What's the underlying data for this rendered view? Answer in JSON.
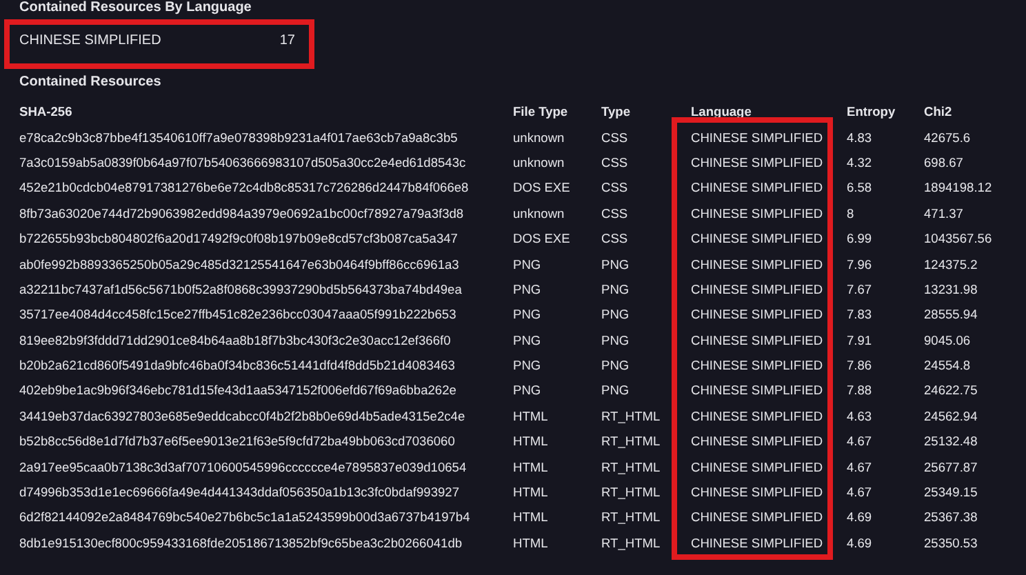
{
  "summary": {
    "title": "Contained Resources By Language",
    "rows": [
      {
        "language": "CHINESE SIMPLIFIED",
        "count": "17",
        "highlighted": true
      }
    ]
  },
  "resources": {
    "title": "Contained Resources",
    "columns": [
      {
        "label": "SHA-256",
        "highlighted": false
      },
      {
        "label": "File Type",
        "highlighted": false
      },
      {
        "label": "Type",
        "highlighted": false
      },
      {
        "label": "Language",
        "highlighted": true
      },
      {
        "label": "Entropy",
        "highlighted": false
      },
      {
        "label": "Chi2",
        "highlighted": false
      }
    ],
    "rows": [
      [
        "e78ca2c9b3c87bbe4f13540610ff7a9e078398b9231a4f017ae63cb7a9a8c3b5",
        "unknown",
        "CSS",
        "CHINESE SIMPLIFIED",
        "4.83",
        "42675.6"
      ],
      [
        "7a3c0159ab5a0839f0b64a97f07b54063666983107d505a30cc2e4ed61d8543c",
        "unknown",
        "CSS",
        "CHINESE SIMPLIFIED",
        "4.32",
        "698.67"
      ],
      [
        "452e21b0cdcb04e87917381276be6e72c4db8c85317c726286d2447b84f066e8",
        "DOS EXE",
        "CSS",
        "CHINESE SIMPLIFIED",
        "6.58",
        "1894198.12"
      ],
      [
        "8fb73a63020e744d72b9063982edd984a3979e0692a1bc00cf78927a79a3f3d8",
        "unknown",
        "CSS",
        "CHINESE SIMPLIFIED",
        "8",
        "471.37"
      ],
      [
        "b722655b93bcb804802f6a20d17492f9c0f08b197b09e8cd57cf3b087ca5a347",
        "DOS EXE",
        "CSS",
        "CHINESE SIMPLIFIED",
        "6.99",
        "1043567.56"
      ],
      [
        "ab0fe992b8893365250b05a29c485d32125541647e63b0464f9bff86cc6961a3",
        "PNG",
        "PNG",
        "CHINESE SIMPLIFIED",
        "7.96",
        "124375.2"
      ],
      [
        "a32211bc7437af1d56c5671b0f52a8f0868c39937290bd5b564373ba74bd49ea",
        "PNG",
        "PNG",
        "CHINESE SIMPLIFIED",
        "7.67",
        "13231.98"
      ],
      [
        "35717ee4084d4cc458fc15ce27ffb451c82e236bcc03047aaa05f991b222b653",
        "PNG",
        "PNG",
        "CHINESE SIMPLIFIED",
        "7.83",
        "28555.94"
      ],
      [
        "819ee82b9f3fddd71dd2901ce84b64aa8b18f7b3bc430f3c2e30acc12ef366f0",
        "PNG",
        "PNG",
        "CHINESE SIMPLIFIED",
        "7.91",
        "9045.06"
      ],
      [
        "b20b2a621cd860f5491da9bfc46ba0f34bc836c51441dfd4f8dd5b21d4083463",
        "PNG",
        "PNG",
        "CHINESE SIMPLIFIED",
        "7.86",
        "24554.8"
      ],
      [
        "402eb9be1ac9b96f346ebc781d15fe43d1aa5347152f006efd67f69a6bba262e",
        "PNG",
        "PNG",
        "CHINESE SIMPLIFIED",
        "7.88",
        "24622.75"
      ],
      [
        "34419eb37dac63927803e685e9eddcabcc0f4b2f2b8b0e69d4b5ade4315e2c4e",
        "HTML",
        "RT_HTML",
        "CHINESE SIMPLIFIED",
        "4.63",
        "24562.94"
      ],
      [
        "b52b8cc56d8e1d7fd7b37e6f5ee9013e21f63e5f9cfd72ba49bb063cd7036060",
        "HTML",
        "RT_HTML",
        "CHINESE SIMPLIFIED",
        "4.67",
        "25132.48"
      ],
      [
        "2a917ee95caa0b7138c3d3af70710600545996cccccce4e7895837e039d10654",
        "HTML",
        "RT_HTML",
        "CHINESE SIMPLIFIED",
        "4.67",
        "25677.87"
      ],
      [
        "d74996b353d1e1ec69666fa49e4d441343ddaf056350a1b13c3fc0bdaf993927",
        "HTML",
        "RT_HTML",
        "CHINESE SIMPLIFIED",
        "4.67",
        "25349.15"
      ],
      [
        "6d2f82144092e2a8484769bc540e27b6bc5c1a1a5243599b00d3a6737b4197b4",
        "HTML",
        "RT_HTML",
        "CHINESE SIMPLIFIED",
        "4.69",
        "25367.38"
      ],
      [
        "8db1e915130ecf800c959433168fde205186713852bf9c65bea3c2b0266041db",
        "HTML",
        "RT_HTML",
        "CHINESE SIMPLIFIED",
        "4.69",
        "25350.53"
      ]
    ]
  }
}
